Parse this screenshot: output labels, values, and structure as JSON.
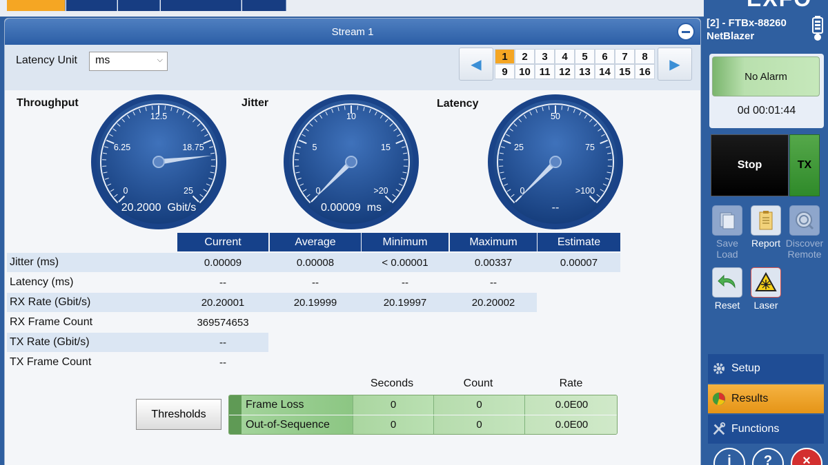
{
  "top_tabs": [
    {
      "state": "active"
    },
    {
      "state": "inactive"
    },
    {
      "state": "inactive"
    },
    {
      "state": "inactive"
    },
    {
      "state": "inactive"
    }
  ],
  "panel": {
    "title": "Stream 1",
    "zoom_icon": "zoom-out-icon"
  },
  "latency_unit": {
    "label": "Latency Unit",
    "value": "ms"
  },
  "stream_nav": {
    "prev_icon": "arrow-left-icon",
    "next_icon": "arrow-right-icon",
    "selected": "1",
    "streams": [
      "1",
      "2",
      "3",
      "4",
      "5",
      "6",
      "7",
      "8",
      "9",
      "10",
      "11",
      "12",
      "13",
      "14",
      "15",
      "16"
    ]
  },
  "gauges": {
    "throughput": {
      "title": "Throughput",
      "ticks": [
        "0",
        "6.25",
        "12.5",
        "18.75",
        "25"
      ],
      "value": "20.2000",
      "unit": "Gbit/s",
      "level_fraction": 0.808
    },
    "jitter": {
      "title": "Jitter",
      "ticks": [
        "0",
        "5",
        "10",
        "15",
        ">20"
      ],
      "value": "0.00009",
      "unit": "ms",
      "level_fraction": 0.0
    },
    "latency": {
      "title": "Latency",
      "ticks": [
        "0",
        "25",
        "50",
        "75",
        ">100"
      ],
      "value": "--",
      "unit": "",
      "level_fraction": 0.0
    }
  },
  "stats": {
    "columns": [
      "Current",
      "Average",
      "Minimum",
      "Maximum",
      "Estimate"
    ],
    "rows": [
      {
        "label": "Jitter (ms)",
        "values": [
          "0.00009",
          "0.00008",
          "< 0.00001",
          "0.00337",
          "0.00007"
        ]
      },
      {
        "label": "Latency (ms)",
        "values": [
          "--",
          "--",
          "--",
          "--"
        ]
      },
      {
        "label": "RX Rate (Gbit/s)",
        "values": [
          "20.20001",
          "20.19999",
          "20.19997",
          "20.20002"
        ]
      },
      {
        "label": "RX Frame Count",
        "values": [
          "369574653"
        ]
      },
      {
        "label": "TX Rate (Gbit/s)",
        "values": [
          "--"
        ]
      },
      {
        "label": "TX Frame Count",
        "values": [
          "--"
        ]
      }
    ]
  },
  "errors": {
    "thresholds_label": "Thresholds",
    "columns": [
      "Seconds",
      "Count",
      "Rate"
    ],
    "rows": [
      {
        "label": "Frame Loss",
        "seconds": "0",
        "count": "0",
        "rate": "0.0E00"
      },
      {
        "label": "Out-of-Sequence",
        "seconds": "0",
        "count": "0",
        "rate": "0.0E00"
      }
    ]
  },
  "sidebar": {
    "brand": "EXFO",
    "module_line1": "[2] - FTBx-88260",
    "module_line2": "NetBlazer",
    "battery_icon": "battery-icon",
    "alarm_status": "No Alarm",
    "timer": "0d 00:01:44",
    "stop_label": "Stop",
    "tx_label": "TX",
    "tools": [
      {
        "label1": "Save",
        "label2": "Load",
        "icon": "save-load-icon",
        "enabled": false
      },
      {
        "label1": "Report",
        "label2": "",
        "icon": "report-icon",
        "enabled": true
      },
      {
        "label1": "Discover",
        "label2": "Remote",
        "icon": "discover-remote-icon",
        "enabled": false
      },
      {
        "label1": "Reset",
        "label2": "",
        "icon": "reset-icon",
        "enabled": true
      },
      {
        "label1": "Laser",
        "label2": "",
        "icon": "laser-warning-icon",
        "enabled": true
      }
    ],
    "menu": [
      {
        "label": "Setup",
        "icon": "gear-icon"
      },
      {
        "label": "Results",
        "icon": "pie-chart-icon"
      },
      {
        "label": "Functions",
        "icon": "tools-icon"
      }
    ],
    "bottom_buttons": [
      {
        "icon": "info-icon",
        "color": "#2f5fa0"
      },
      {
        "icon": "help-icon",
        "color": "#2f5fa0"
      },
      {
        "icon": "exit-icon",
        "color": "#d32f2f"
      }
    ]
  }
}
